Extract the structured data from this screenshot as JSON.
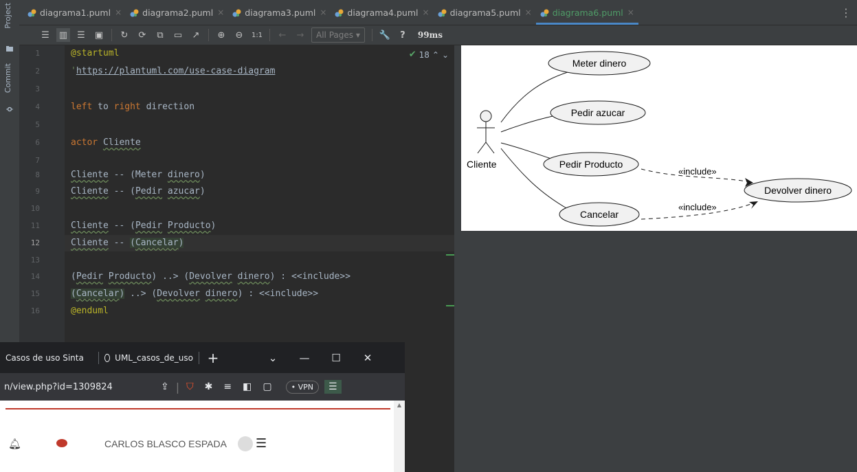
{
  "sidebar": {
    "project_label": "Project",
    "commit_label": "Commit"
  },
  "tabs": [
    {
      "label": "diagrama1.puml",
      "active": false
    },
    {
      "label": "diagrama2.puml",
      "active": false
    },
    {
      "label": "diagrama3.puml",
      "active": false
    },
    {
      "label": "diagrama4.puml",
      "active": false
    },
    {
      "label": "diagrama5.puml",
      "active": false
    },
    {
      "label": "diagrama6.puml",
      "active": true
    }
  ],
  "toolbar": {
    "zoom_actual": "1:1",
    "pages_dropdown": "All Pages",
    "help": "?",
    "render_time": "99ms"
  },
  "editor": {
    "inspection_count": "18",
    "current_line": 12,
    "line_numbers": [
      "1",
      "2",
      "3",
      "4",
      "5",
      "6",
      "7",
      "8",
      "9",
      "10",
      "11",
      "12",
      "13",
      "14",
      "15",
      "16"
    ]
  },
  "diagram": {
    "actor": "Cliente",
    "use_cases": [
      "Meter dinero",
      "Pedir azucar",
      "Pedir Producto",
      "Cancelar",
      "Devolver dinero"
    ],
    "include_label": "«include»"
  },
  "browser": {
    "tab1": "Casos de uso Sinta",
    "tab2": "UML_casos_de_uso",
    "address": "n/view.php?id=1309824",
    "vpn": "VPN",
    "user_name": "CARLOS BLASCO ESPADA"
  },
  "colors": {
    "editor_bg": "#2b2b2b",
    "keyword": "#cc7832",
    "annotation": "#bbb529",
    "active_tab": "#4f9c67"
  }
}
